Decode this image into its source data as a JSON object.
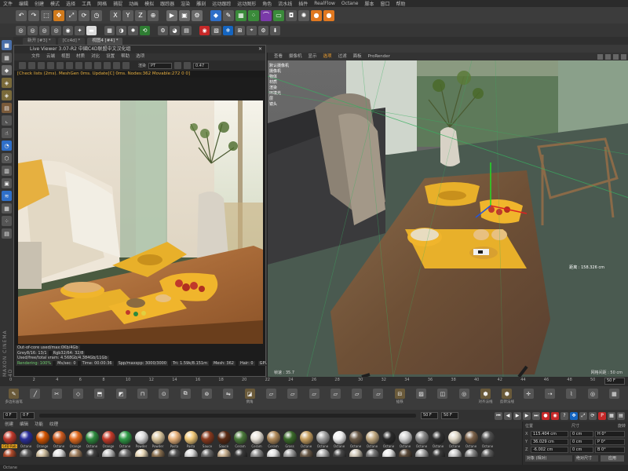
{
  "menubar": [
    "文件",
    "编辑",
    "创建",
    "模式",
    "选择",
    "工具",
    "网格",
    "捕捉",
    "动画",
    "模拟",
    "跟踪器",
    "渲染",
    "雕刻",
    "运动跟踪",
    "运动图形",
    "角色",
    "流水线",
    "插件",
    "RealFlow",
    "Octane",
    "脚本",
    "窗口",
    "帮助"
  ],
  "toolbar1_icons": [
    {
      "name": "undo-icon",
      "glyph": "↶",
      "color": "#5a5a5a"
    },
    {
      "name": "redo-icon",
      "glyph": "↷",
      "color": "#5a5a5a"
    },
    {
      "name": "live-select-icon",
      "glyph": "⬚",
      "color": "#5a5a5a"
    },
    {
      "name": "move-icon",
      "glyph": "✥",
      "color": "#d07a1c"
    },
    {
      "name": "scale-icon",
      "glyph": "⤢",
      "color": "#5a5a5a"
    },
    {
      "name": "rotate-icon",
      "glyph": "⟳",
      "color": "#5a5a5a"
    },
    {
      "name": "recent-icon",
      "glyph": "◷",
      "color": "#5a5a5a"
    },
    {
      "name": "x-axis-icon",
      "glyph": "X",
      "color": "#5a5a5a"
    },
    {
      "name": "y-axis-icon",
      "glyph": "Y",
      "color": "#5a5a5a"
    },
    {
      "name": "z-axis-icon",
      "glyph": "Z",
      "color": "#5a5a5a"
    },
    {
      "name": "coord-system-icon",
      "glyph": "⊕",
      "color": "#5a5a5a"
    },
    {
      "name": "render-view-icon",
      "glyph": "▶",
      "color": "#6a6a6a"
    },
    {
      "name": "render-picture-icon",
      "glyph": "▣",
      "color": "#6a6a6a"
    },
    {
      "name": "render-settings-icon",
      "glyph": "⚙",
      "color": "#6a6a6a"
    },
    {
      "name": "cube-icon",
      "glyph": "◆",
      "color": "#2f6fc8"
    },
    {
      "name": "pen-icon",
      "glyph": "✎",
      "color": "#5a5a5a"
    },
    {
      "name": "subdivision-icon",
      "glyph": "▦",
      "color": "#3a8a3a"
    },
    {
      "name": "array-icon",
      "glyph": "⁘",
      "color": "#3a8a3a"
    },
    {
      "name": "bend-icon",
      "glyph": "⌒",
      "color": "#7a3aa8"
    },
    {
      "name": "floor-icon",
      "glyph": "▭",
      "color": "#3a8a3a"
    },
    {
      "name": "camera-icon",
      "glyph": "◘",
      "color": "#555"
    },
    {
      "name": "light-icon",
      "glyph": "✺",
      "color": "#5a5a5a"
    },
    {
      "name": "octane-orange-icon",
      "glyph": "●",
      "color": "#e07820"
    },
    {
      "name": "octane-orange2-icon",
      "glyph": "●",
      "color": "#e07820"
    }
  ],
  "toolbar2_icons": [
    {
      "name": "points-mode-icon",
      "glyph": "◎",
      "color": "#555"
    },
    {
      "name": "edges-mode-icon",
      "glyph": "◎",
      "color": "#555"
    },
    {
      "name": "polygons-mode-icon",
      "glyph": "◎",
      "color": "#555"
    },
    {
      "name": "model-mode-icon",
      "glyph": "◎",
      "color": "#555"
    },
    {
      "name": "texture-mode-icon",
      "glyph": "◉",
      "color": "#555"
    },
    {
      "name": "axis-mode-icon",
      "glyph": "✦",
      "color": "#555"
    },
    {
      "name": "toggle-icon",
      "glyph": "▬",
      "color": "#ddd"
    },
    {
      "name": "grid-snap-icon",
      "glyph": "▦",
      "color": "#555"
    },
    {
      "name": "contrast-icon",
      "glyph": "◑",
      "color": "#555"
    },
    {
      "name": "sun-icon",
      "glyph": "✹",
      "color": "#555"
    },
    {
      "name": "refresh-icon",
      "glyph": "⟲",
      "color": "#2e7d32"
    },
    {
      "name": "octane-settings-icon",
      "glyph": "⚙",
      "color": "#555"
    },
    {
      "name": "palette-icon",
      "glyph": "◕",
      "color": "#555"
    },
    {
      "name": "film-icon",
      "glyph": "▤",
      "color": "#555"
    },
    {
      "name": "record-icon",
      "glyph": "◉",
      "color": "#c62828"
    },
    {
      "name": "image-icon",
      "glyph": "▧",
      "color": "#555"
    },
    {
      "name": "snow-icon",
      "glyph": "❄",
      "color": "#1565c0"
    },
    {
      "name": "select-icon",
      "glyph": "⊞",
      "color": "#555"
    },
    {
      "name": "crosshair-icon",
      "glyph": "⌖",
      "color": "#555"
    },
    {
      "name": "gear2-icon",
      "glyph": "⚙",
      "color": "#555"
    },
    {
      "name": "download-icon",
      "glyph": "⬇",
      "color": "#555"
    }
  ],
  "left_icons": [
    {
      "name": "model-tool-icon",
      "glyph": "■",
      "color": "#4a6fa8"
    },
    {
      "name": "checker-icon",
      "glyph": "▦",
      "color": "#555"
    },
    {
      "name": "cube-tool-icon",
      "glyph": "◆",
      "color": "#6a6a6a"
    },
    {
      "name": "box-tool-icon",
      "glyph": "◈",
      "color": "#7a6a3a"
    },
    {
      "name": "box2-tool-icon",
      "glyph": "◈",
      "color": "#7a6a3a"
    },
    {
      "name": "stack-tool-icon",
      "glyph": "▤",
      "color": "#7a5a3a"
    },
    {
      "name": "l-shape-icon",
      "glyph": "⌞",
      "color": "#555"
    },
    {
      "name": "pointer-tool-icon",
      "glyph": "☝",
      "color": "#555"
    },
    {
      "name": "magnet-icon",
      "glyph": "◔",
      "color": "#2f6fc8"
    },
    {
      "name": "snap-icon",
      "glyph": "⬡",
      "color": "#555"
    },
    {
      "name": "stripe-icon",
      "glyph": "▥",
      "color": "#555"
    },
    {
      "name": "lock-tool-icon",
      "glyph": "▣",
      "color": "#555"
    },
    {
      "name": "wave-icon",
      "glyph": "≋",
      "color": "#2f6fc8"
    },
    {
      "name": "grid-tool-icon",
      "glyph": "▦",
      "color": "#555"
    },
    {
      "name": "dots-icon",
      "glyph": "⁘",
      "color": "#555"
    },
    {
      "name": "layers-icon",
      "glyph": "▤",
      "color": "#555"
    }
  ],
  "left_vertical_text": "MAXON CINEMA 4D",
  "tabs": [
    {
      "label": "新开 [#3] *",
      "active": false
    },
    {
      "label": "[Cc4d] *",
      "active": false
    },
    {
      "label": "视图4 [#4] *",
      "active": true
    }
  ],
  "live_viewer": {
    "title": "Live Viewer 3.07-R2 中國C4D联盟中文汉化组",
    "menu": [
      "文件",
      "云端",
      "视图",
      "材质",
      "对比",
      "设置",
      "帮助",
      "选项"
    ],
    "channel_label": "渲染",
    "channel_value": "PT",
    "zoom_value": "0.47",
    "status": "[Check lists (2ms). MeshGen 0ms. Update[C] 0ms. Nodes:362 Movable:272 0 0]",
    "info_rows": [
      [
        "Out-of-core used/max:0Kb/4Gb"
      ],
      [
        "Grey8/16: 13/1",
        "Rgb32/64: 32/8"
      ],
      [
        "Used/free/total vram: 4.568Gb/4.384Gb/11Gb"
      ],
      [
        "Rendering: 100%",
        "Ms/sec: 0",
        "Time: 00:00:36",
        "Spp/maxspp: 3000/3000",
        "Tri: 1.59k/8.151m",
        "Mesh: 362",
        "Hair: 0",
        "GPU:",
        "41°C"
      ]
    ]
  },
  "viewport": {
    "menu": [
      "查看",
      "摄像机",
      "显示",
      "选项",
      "过滤",
      "面板",
      "ProRender"
    ],
    "menu_highlight_index": 3,
    "side_labels": [
      "默认摄像机",
      "摄像机",
      "物体",
      "材质",
      "渲染",
      "环境光",
      "层",
      "镜头"
    ],
    "distance_label": "距离 : 158.326 cm",
    "bottom_left": "帧速 : 35.7",
    "bottom_right": "网格间距 : 50 cm"
  },
  "timeline": {
    "ticks": [
      "0",
      "2",
      "4",
      "6",
      "8",
      "10",
      "12",
      "14",
      "16",
      "18",
      "20",
      "22",
      "24",
      "26",
      "28",
      "30",
      "32",
      "34",
      "36",
      "38",
      "40",
      "42",
      "44",
      "46",
      "48",
      "50"
    ],
    "frame": "50 F"
  },
  "bottom_tools": [
    {
      "label": "多边形画笔",
      "icon": "pen-tool-icon",
      "glyph": "✎"
    },
    {
      "label": "",
      "icon": "line-tool-icon",
      "glyph": "╱"
    },
    {
      "label": "",
      "icon": "knife-icon",
      "glyph": "✂"
    },
    {
      "label": "",
      "icon": "cube-outline-icon",
      "glyph": "◇"
    },
    {
      "label": "",
      "icon": "extrude-icon",
      "glyph": "⬒"
    },
    {
      "label": "",
      "icon": "bevel-icon",
      "glyph": "◩"
    },
    {
      "label": "",
      "icon": "bridge-icon",
      "glyph": "⊓"
    },
    {
      "label": "",
      "icon": "weld-icon",
      "glyph": "⊙"
    },
    {
      "label": "",
      "icon": "mirror-icon",
      "glyph": "⧉"
    },
    {
      "label": "",
      "icon": "loop-icon",
      "glyph": "⊚"
    },
    {
      "label": "",
      "icon": "slide-icon",
      "glyph": "⇋"
    },
    {
      "label": "倒角",
      "icon": "chamfer-icon",
      "glyph": "◪"
    },
    {
      "label": "",
      "icon": "plane-icon",
      "glyph": "▱"
    },
    {
      "label": "",
      "icon": "plane2-icon",
      "glyph": "▱"
    },
    {
      "label": "",
      "icon": "plane3-icon",
      "glyph": "▱"
    },
    {
      "label": "",
      "icon": "plane4-icon",
      "glyph": "▱"
    },
    {
      "label": "",
      "icon": "plane5-icon",
      "glyph": "▱"
    },
    {
      "label": "",
      "icon": "plane6-icon",
      "glyph": "▱"
    },
    {
      "label": "插铁",
      "icon": "insert-icon",
      "glyph": "⊟"
    },
    {
      "label": "",
      "icon": "dissolve-icon",
      "glyph": "▨"
    },
    {
      "label": "",
      "icon": "split-icon",
      "glyph": "◫"
    },
    {
      "label": "",
      "icon": "magnet-tool-icon",
      "glyph": "◎"
    },
    {
      "label": "对齐法线",
      "icon": "align-normal-icon",
      "glyph": "⬢"
    },
    {
      "label": "反转法线",
      "icon": "reverse-normal-icon",
      "glyph": "⬢"
    },
    {
      "label": "",
      "icon": "move-tool-icon",
      "glyph": "✛"
    },
    {
      "label": "",
      "icon": "arrow-tool-icon",
      "glyph": "⇢"
    },
    {
      "label": "",
      "icon": "brush-tool-icon",
      "glyph": "⌇"
    },
    {
      "label": "",
      "icon": "target-tool-icon",
      "glyph": "◎"
    },
    {
      "label": "",
      "icon": "grid-tool2-icon",
      "glyph": "▦"
    }
  ],
  "playback": {
    "start": "0 F",
    "current": "50 F",
    "end": "50 F"
  },
  "materials": {
    "menu": [
      "创建",
      "编辑",
      "功能",
      "纹理"
    ],
    "row1": [
      {
        "name": "C4D Rub",
        "color": "#c0392b",
        "selected": true
      },
      {
        "name": "Octane",
        "color": "#2b2f9a",
        "selected": false
      },
      {
        "name": "Orange",
        "color": "#d35400",
        "selected": false
      },
      {
        "name": "Octane",
        "color": "#cc5a1e",
        "selected": false
      },
      {
        "name": "Orange",
        "color": "#e06a1e",
        "selected": false
      },
      {
        "name": "Octane",
        "color": "#2d8a3e",
        "selected": false
      },
      {
        "name": "Orange",
        "color": "#c43b2a",
        "selected": false
      },
      {
        "name": "Octane",
        "color": "#2e9a46",
        "selected": false
      },
      {
        "name": "Powder",
        "color": "#dcdcdc",
        "selected": false
      },
      {
        "name": "Powder",
        "color": "#d8c49c",
        "selected": false
      },
      {
        "name": "Pasta",
        "color": "#e6b07a",
        "selected": false
      },
      {
        "name": "Pasta",
        "color": "#f0c878",
        "selected": false
      },
      {
        "name": "Sauce",
        "color": "#8a3a1e",
        "selected": false
      },
      {
        "name": "Sauce",
        "color": "#5a2a14",
        "selected": false
      },
      {
        "name": "Ceram",
        "color": "#4a7a3a",
        "selected": false
      },
      {
        "name": "Ceram",
        "color": "#e8e2d8",
        "selected": false
      },
      {
        "name": "Ceram",
        "color": "#b08a5a",
        "selected": false
      },
      {
        "name": "Grass",
        "color": "#3a6a2a",
        "selected": false
      },
      {
        "name": "Octane",
        "color": "#c8a060",
        "selected": false
      },
      {
        "name": "Octane",
        "color": "#a0a0a0",
        "selected": false
      },
      {
        "name": "Octane",
        "color": "#f0f0f0",
        "selected": false
      },
      {
        "name": "Octane",
        "color": "#6a5a48",
        "selected": false
      },
      {
        "name": "Octane",
        "color": "#c0a880",
        "selected": false
      },
      {
        "name": "Octane",
        "color": "#2a2a2a",
        "selected": false
      },
      {
        "name": "Octane",
        "color": "#d0d0d0",
        "selected": false
      },
      {
        "name": "Octane",
        "color": "#8a8a8a",
        "selected": false
      },
      {
        "name": "Octane",
        "color": "#303030",
        "selected": false
      },
      {
        "name": "Octane",
        "color": "#e0d8c8",
        "selected": false
      },
      {
        "name": "Octane",
        "color": "#7a6048",
        "selected": false
      },
      {
        "name": "Octane",
        "color": "#505050",
        "selected": false
      }
    ],
    "row2_colors": [
      "#b04a2a",
      "#5a5a5a",
      "#d0c0a0",
      "#e0e0e0",
      "#a08060",
      "#404040",
      "#c0c0c0",
      "#707070",
      "#e8d8b8",
      "#8a7050",
      "#505050",
      "#d8d8d8",
      "#6a6a6a",
      "#c8b090",
      "#3a3a3a",
      "#909090",
      "#e0e0e0",
      "#a0a0a0",
      "#6a5a48",
      "#b0b0b0",
      "#484848",
      "#d0c8b8",
      "#787878",
      "#e8e8e8",
      "#5a4a3a",
      "#a8a8a8",
      "#3a3a3a",
      "#c8c8c8",
      "#8a8a8a",
      "#606060"
    ]
  },
  "coords": {
    "headers": [
      "位置",
      "尺寸",
      "旋转"
    ],
    "rows": [
      {
        "axis": "X",
        "pos": "115.404 cm",
        "size": "0 cm",
        "rot": "H 0°"
      },
      {
        "axis": "Y",
        "pos": "36.029 cm",
        "size": "0 cm",
        "rot": "P 0°"
      },
      {
        "axis": "Z",
        "pos": "-6.002 cm",
        "size": "0 cm",
        "rot": "B 0°"
      }
    ],
    "mode": "对象 (相对)",
    "size_mode": "绝对尺寸",
    "apply": "应用"
  },
  "statusbar": "Octane"
}
